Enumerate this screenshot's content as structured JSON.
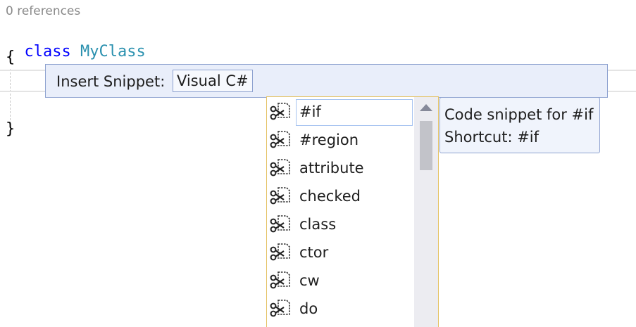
{
  "editor": {
    "codelens": "0 references",
    "line_keyword": "class",
    "line_classname": "MyClass",
    "open_brace": "{",
    "close_brace": "}"
  },
  "snippet_bar": {
    "label": "Insert Snippet:",
    "language": "Visual C#"
  },
  "completion": {
    "items": [
      {
        "label": "#if",
        "icon": "snippet-icon",
        "selected": true
      },
      {
        "label": "#region",
        "icon": "snippet-icon"
      },
      {
        "label": "attribute",
        "icon": "snippet-icon"
      },
      {
        "label": "checked",
        "icon": "snippet-icon"
      },
      {
        "label": "class",
        "icon": "snippet-icon"
      },
      {
        "label": "ctor",
        "icon": "snippet-icon"
      },
      {
        "label": "cw",
        "icon": "snippet-icon"
      },
      {
        "label": "do",
        "icon": "snippet-icon"
      }
    ]
  },
  "tooltip": {
    "line1": "Code snippet for #if",
    "line2": "Shortcut: #if"
  },
  "colors": {
    "keyword": "#0000ff",
    "type": "#2b91af",
    "list_border": "#e5c365",
    "bar_bg": "#e9eefa"
  }
}
